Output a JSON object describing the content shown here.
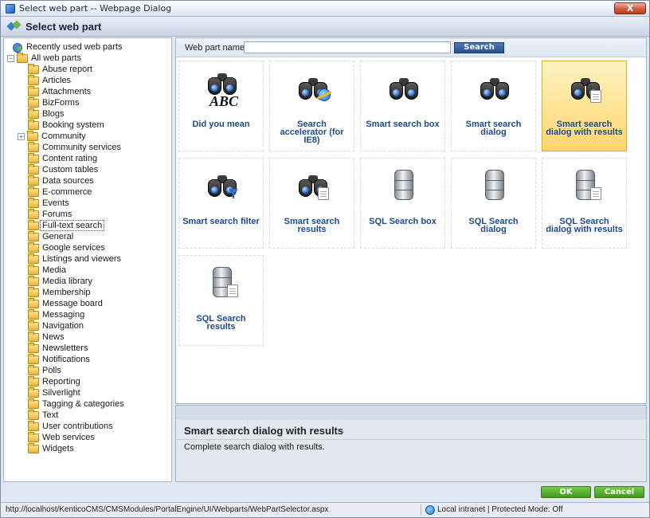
{
  "window": {
    "title": "Select web part -- Webpage Dialog",
    "close_label": "X"
  },
  "header": {
    "title": "Select web part"
  },
  "tree": {
    "recent": "Recently used web parts",
    "root": "All web parts",
    "expander": "+",
    "items": [
      "Abuse report",
      "Articles",
      "Attachments",
      "BizForms",
      "Blogs",
      "Booking system",
      "Community",
      "Community services",
      "Content rating",
      "Custom tables",
      "Data sources",
      "E-commerce",
      "Events",
      "Forums",
      "Full-text search",
      "General",
      "Google services",
      "Listings and viewers",
      "Media",
      "Media library",
      "Membership",
      "Message board",
      "Messaging",
      "Navigation",
      "News",
      "Newsletters",
      "Notifications",
      "Polls",
      "Reporting",
      "Silverlight",
      "Tagging & categories",
      "Text",
      "User contributions",
      "Web services",
      "Widgets"
    ],
    "selected": "Full-text search"
  },
  "search": {
    "label": "Web part name:",
    "value": "",
    "button": "Search"
  },
  "tiles": [
    {
      "label": "Did you mean",
      "icon": "binoculars-abc-icon"
    },
    {
      "label": "Search accelerator (for IE8)",
      "icon": "binoculars-ie-icon"
    },
    {
      "label": "Smart search box",
      "icon": "binoculars-icon"
    },
    {
      "label": "Smart search dialog",
      "icon": "binoculars-icon"
    },
    {
      "label": "Smart search dialog with results",
      "icon": "binoculars-document-icon",
      "selected": true
    },
    {
      "label": "Smart search filter",
      "icon": "binoculars-filter-icon"
    },
    {
      "label": "Smart search results",
      "icon": "binoculars-document-icon"
    },
    {
      "label": "SQL Search box",
      "icon": "database-binoculars-icon"
    },
    {
      "label": "SQL Search dialog",
      "icon": "database-binoculars-icon"
    },
    {
      "label": "SQL Search dialog with results",
      "icon": "database-document-icon"
    },
    {
      "label": "SQL Search results",
      "icon": "database-document-icon"
    }
  ],
  "detail": {
    "title": "Smart search dialog with results",
    "description": "Complete search dialog with results."
  },
  "buttons": {
    "ok": "OK",
    "cancel": "Cancel"
  },
  "status": {
    "url": "http://localhost/KenticoCMS/CMSModules/PortalEngine/UI/Webparts/WebPartSelector.aspx",
    "zone": "Local intranet | Protected Mode: Off"
  },
  "colors": {
    "selection_fill": "#ffd66e",
    "tile_label": "#1d4a8c",
    "ok_button": "#3e9b1a"
  }
}
